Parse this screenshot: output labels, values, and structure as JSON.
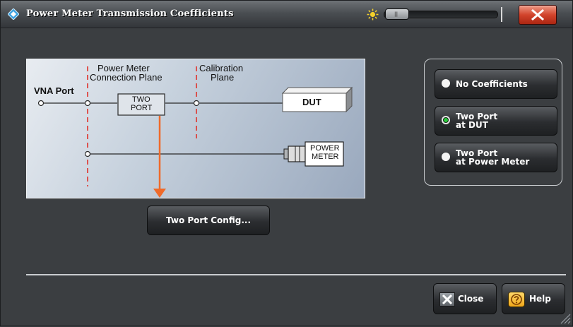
{
  "window": {
    "title": "Power Meter Transmission Coefficients"
  },
  "icons": {
    "app": "rohde-schwarz-diamond-icon",
    "brightness": "sun-icon",
    "close": "close-x-icon",
    "help": "help-question-icon"
  },
  "colors": {
    "accent_red": "#d2442c",
    "selected_green": "#29c83a",
    "arrow_orange": "#ef6a2a"
  },
  "diagram": {
    "vna_port": "VNA Port",
    "pm_plane_line1": "Power Meter",
    "pm_plane_line2": "Connection Plane",
    "cal_plane_line1": "Calibration",
    "cal_plane_line2": "Plane",
    "two_port_line1": "TWO",
    "two_port_line2": "PORT",
    "dut": "DUT",
    "power_meter_line1": "POWER",
    "power_meter_line2": "METER"
  },
  "buttons": {
    "two_port_config": "Two Port Config...",
    "close": "Close",
    "help": "Help"
  },
  "radio_options": [
    {
      "line1": "No Coefficients",
      "line2": "",
      "selected": false
    },
    {
      "line1": "Two Port",
      "line2": "at DUT",
      "selected": true
    },
    {
      "line1": "Two Port",
      "line2": "at Power Meter",
      "selected": false
    }
  ]
}
